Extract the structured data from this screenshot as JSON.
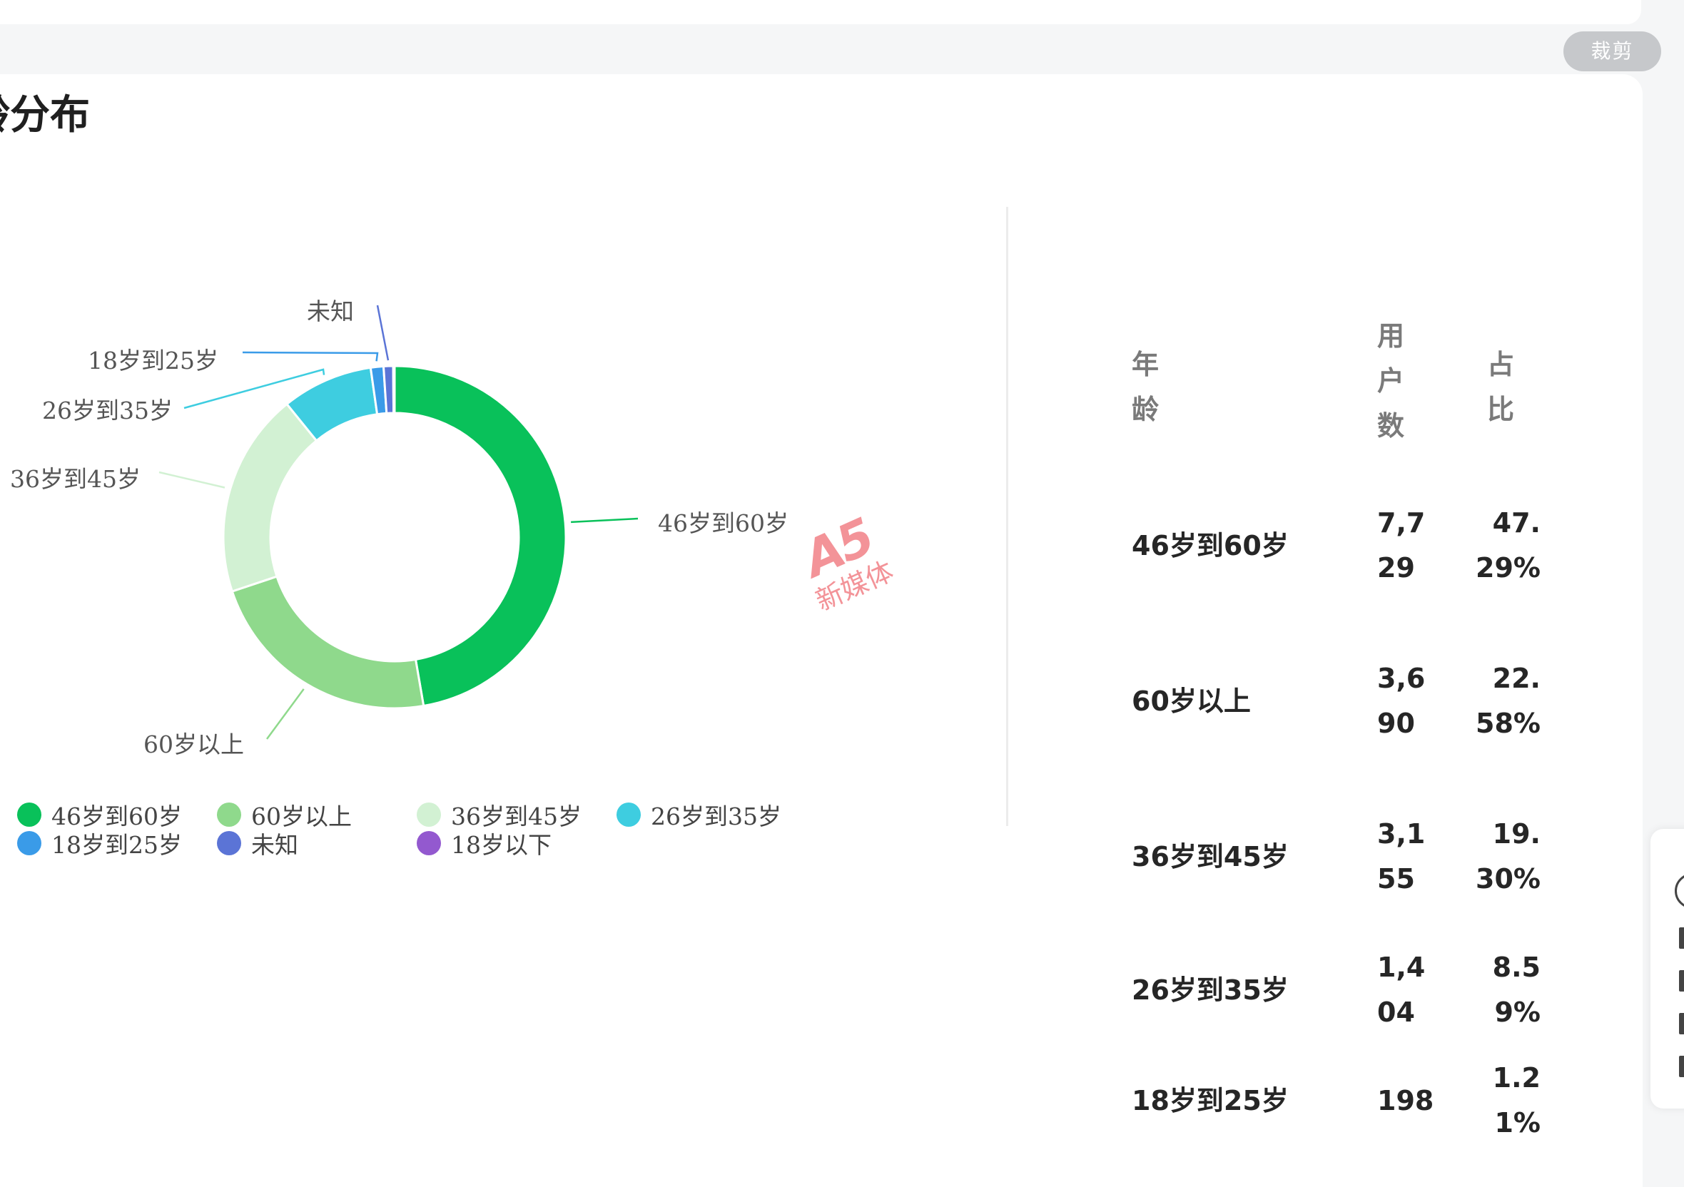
{
  "toolbar": {
    "crop_label": "裁剪"
  },
  "page": {
    "title": "龄分布"
  },
  "watermark": {
    "logo": "A5",
    "text": "新媒体"
  },
  "table": {
    "headers": {
      "age": "年龄",
      "users": "用户数",
      "ratio": "占比"
    },
    "rows": [
      {
        "age": "46岁到60岁",
        "users": "7,729",
        "ratio": "47.29%"
      },
      {
        "age": "60岁以上",
        "users": "3,690",
        "ratio": "22.58%"
      },
      {
        "age": "36岁到45岁",
        "users": "3,155",
        "ratio": "19.30%"
      },
      {
        "age": "26岁到35岁",
        "users": "1,404",
        "ratio": "8.59%"
      },
      {
        "age": "18岁到25岁",
        "users": "198",
        "ratio": "1.21%"
      }
    ]
  },
  "chart_data": {
    "type": "pie",
    "donut": true,
    "title": "",
    "categories": [
      "46岁到60岁",
      "60岁以上",
      "36岁到45岁",
      "26岁到35岁",
      "18岁到25岁",
      "未知",
      "18岁以下"
    ],
    "values": [
      47.29,
      22.58,
      19.3,
      8.59,
      1.21,
      0.9,
      0.13
    ],
    "colors": [
      "#09c15a",
      "#8fd98c",
      "#d2f1d3",
      "#3ecde0",
      "#3a9be8",
      "#5b74d6",
      "#9359cf"
    ],
    "legend_position": "bottom"
  }
}
